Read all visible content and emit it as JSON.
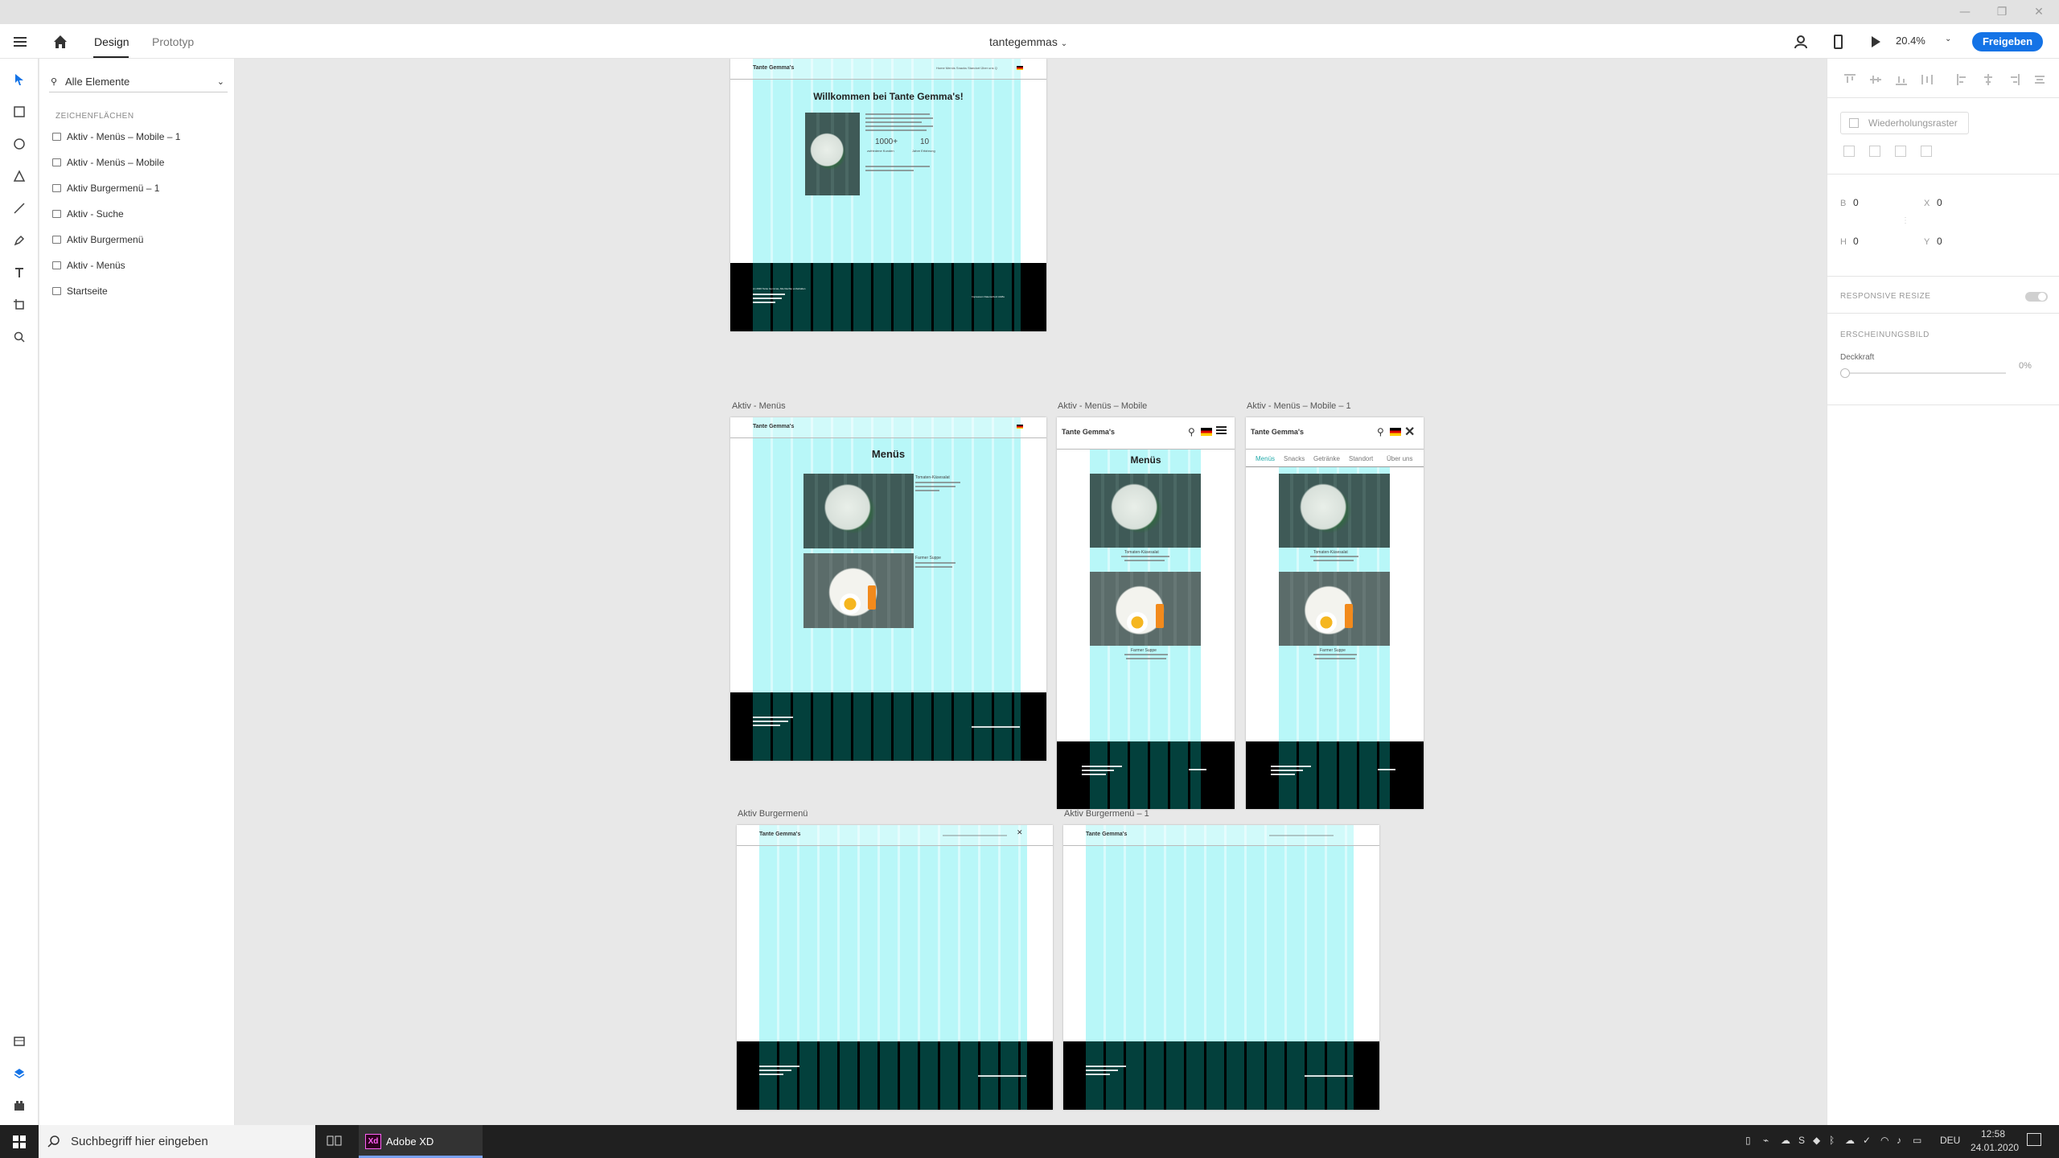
{
  "window": {
    "controls": [
      "—",
      "❐",
      "✕"
    ]
  },
  "toolbar": {
    "menu_icon": "hamburger-icon",
    "home_icon": "home-icon",
    "tabs": [
      {
        "label": "Design",
        "active": true
      },
      {
        "label": "Prototyp",
        "active": false
      }
    ],
    "doc_title": "tantegemmas",
    "zoom": "20.4%",
    "share_label": "Freigeben",
    "accent": "#1473e6"
  },
  "tools": [
    "select-icon",
    "rectangle-icon",
    "ellipse-icon",
    "polygon-icon",
    "line-icon",
    "pen-icon",
    "text-icon",
    "artboard-icon",
    "zoom-icon"
  ],
  "tools_bottom": [
    "assets-icon",
    "layers-icon",
    "plugins-icon"
  ],
  "layers": {
    "filter": "Alle Elemente",
    "section": "ZEICHENFLÄCHEN",
    "items": [
      "Aktiv - Menüs – Mobile – 1",
      "Aktiv - Menüs – Mobile",
      "Aktiv Burgermenü – 1",
      "Aktiv - Suche",
      "Aktiv Burgermenü",
      "Aktiv - Menüs",
      "Startseite"
    ]
  },
  "props": {
    "repeat_grid": "Wiederholungsraster",
    "w_label": "B",
    "w_value": "0",
    "h_label": "H",
    "h_value": "0",
    "x_label": "X",
    "x_value": "0",
    "y_label": "Y",
    "y_value": "0",
    "responsive": "RESPONSIVE RESIZE",
    "appearance": "ERSCHEINUNGSBILD",
    "opacity_label": "Deckkraft",
    "opacity_value": "0%"
  },
  "artboards": {
    "home": {
      "logo": "Tante Gemma's",
      "nav": "Home  Menüs  Snacks  Standort  Über uns  Q",
      "heading": "Willkommen bei Tante Gemma's!",
      "stat1": "1000+",
      "stat1_label": "zufriedene Kunden",
      "stat2": "10",
      "stat2_label": "Jahre Erfahrung",
      "footer_text": "(c) 2020 Tante Gemmas, Alle Rechte vorbehalten",
      "footer_links": "Impressum  Datenschutz  AGBs"
    },
    "menus": {
      "label": "Aktiv - Menüs",
      "logo": "Tante Gemma's",
      "heading": "Menüs",
      "item1": "Tomaten-Käsesalat",
      "item2": "Farmer Suppe"
    },
    "menus_mobile": {
      "label": "Aktiv - Menüs – Mobile",
      "logo": "Tante Gemma's",
      "heading": "Menüs",
      "item1": "Tomaten-Käsesalat",
      "item2": "Farmer Suppe"
    },
    "menus_mobile_1": {
      "label": "Aktiv - Menüs – Mobile – 1",
      "logo": "Tante Gemma's",
      "nav": [
        "Menüs",
        "Snacks",
        "Getränke",
        "Standort",
        "Über uns"
      ],
      "item1": "Tomaten-Käsesalat",
      "item2": "Farmer Suppe"
    },
    "burger": {
      "label": "Aktiv Burgermenü",
      "logo": "Tante Gemma's"
    },
    "burger_1": {
      "label": "Aktiv Burgermenü – 1",
      "logo": "Tante Gemma's"
    }
  },
  "taskbar": {
    "search_placeholder": "Suchbegriff hier eingeben",
    "app_badge": "Xd",
    "app_name": "Adobe XD",
    "lang": "DEU",
    "time": "12:58",
    "date": "24.01.2020"
  }
}
